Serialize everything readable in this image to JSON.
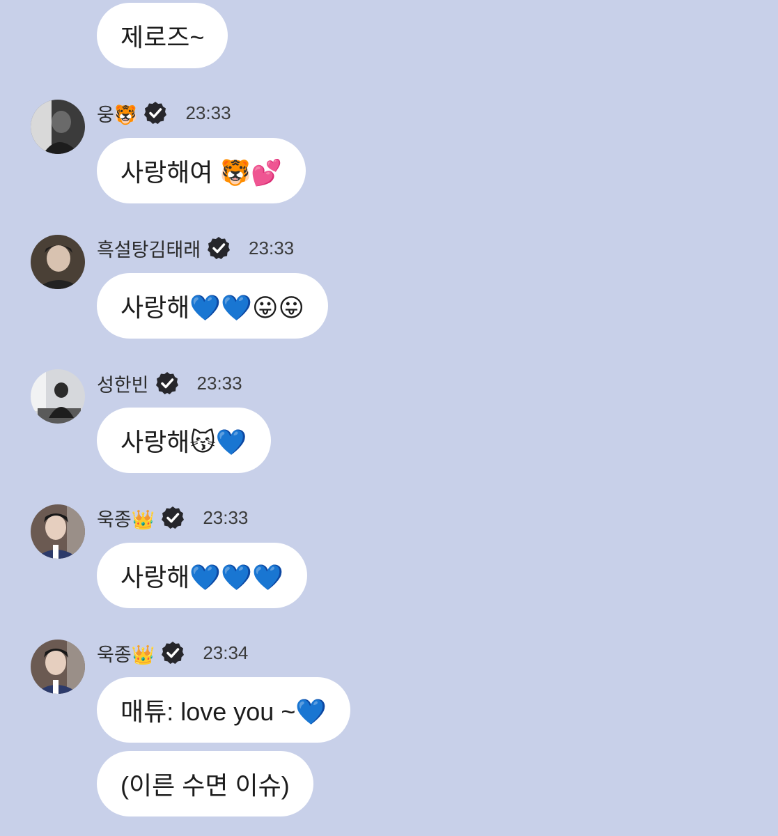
{
  "messages": [
    {
      "continuation": true,
      "bubbles": [
        "제로즈~"
      ]
    },
    {
      "sender": "웅🐯",
      "time": "23:33",
      "avatar_icon": "avatar-photo-woong",
      "bubbles": [
        "사랑해여 🐯💕"
      ]
    },
    {
      "sender": "흑설탕김태래",
      "time": "23:33",
      "avatar_icon": "avatar-photo-taerae",
      "bubbles": [
        "사랑해💙💙😛😛"
      ]
    },
    {
      "sender": "성한빈",
      "time": "23:33",
      "avatar_icon": "avatar-photo-hanbin",
      "bubbles": [
        "사랑해😽💙"
      ]
    },
    {
      "sender": "욱종👑",
      "time": "23:33",
      "avatar_icon": "avatar-photo-ukjong",
      "bubbles": [
        "사랑해💙💙💙"
      ]
    },
    {
      "sender": "욱종👑",
      "time": "23:34",
      "avatar_icon": "avatar-photo-ukjong",
      "bubbles": [
        "매튜: love you ~💙",
        "(이른 수면 이슈)"
      ]
    }
  ],
  "verified_icon": "verified-badge-icon",
  "colors": {
    "background": "#c8d0e9",
    "bubble": "#ffffff",
    "badge": "#26262b"
  }
}
